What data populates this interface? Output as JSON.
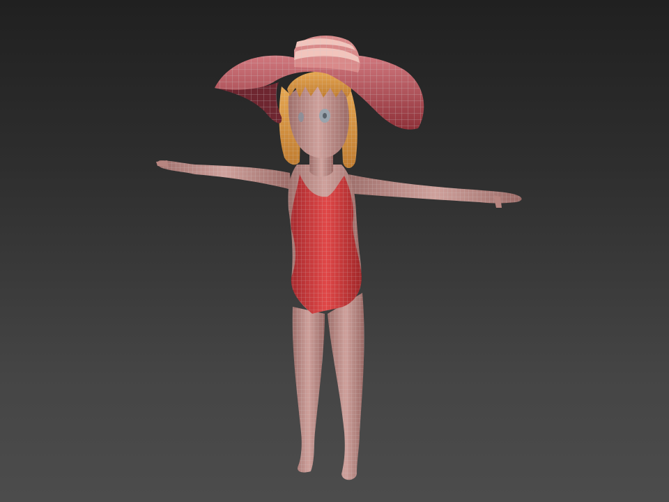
{
  "viewport": {
    "background_top": "#202020",
    "background_bottom": "#4c4c4c"
  },
  "model": {
    "pose": "T-pose",
    "display_mode": "shaded-with-wireframe",
    "wire_color": "#b9b9b9",
    "skin_color": "#c9928c",
    "swimsuit_color": "#d63a3a",
    "hat_color": "#c8606a",
    "hat_band_color": "#e9a7a2",
    "hair_color": "#e0a24a"
  }
}
